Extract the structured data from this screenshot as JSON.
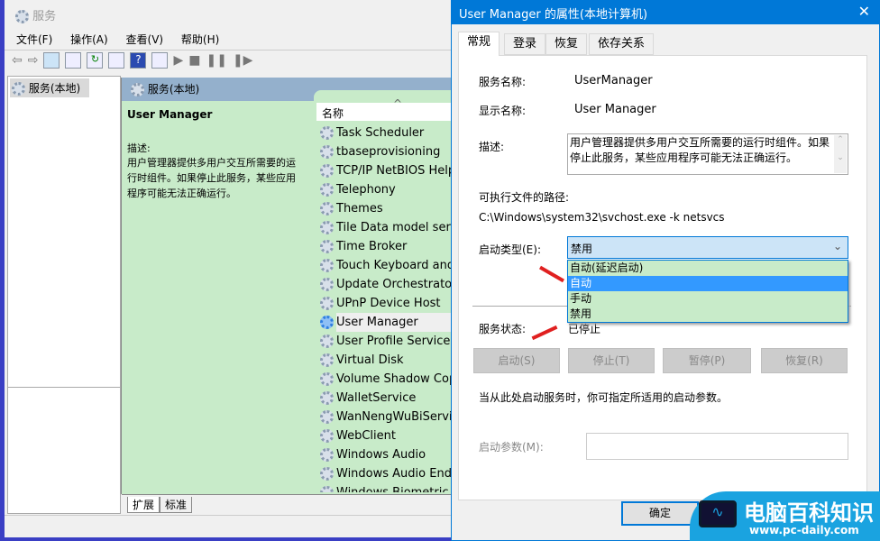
{
  "main_window": {
    "title": "服务",
    "menu": [
      "文件(F)",
      "操作(A)",
      "查看(V)",
      "帮助(H)"
    ],
    "tree": {
      "item": "服务(本地)"
    },
    "pane_header": "服务(本地)",
    "selected_service": {
      "name": "User Manager",
      "desc_label": "描述:",
      "description": "用户管理器提供多用户交互所需要的运行时组件。如果停止此服务，某些应用程序可能无法正确运行。"
    },
    "column_header": "名称",
    "services": [
      "Task Scheduler",
      "tbaseprovisioning",
      "TCP/IP NetBIOS Helper",
      "Telephony",
      "Themes",
      "Tile Data model server",
      "Time Broker",
      "Touch Keyboard and Handwriting",
      "Update Orchestrator Service",
      "UPnP Device Host",
      "User Manager",
      "User Profile Service",
      "Virtual Disk",
      "Volume Shadow Copy",
      "WalletService",
      "WanNengWuBiService",
      "WebClient",
      "Windows Audio",
      "Windows Audio Endpoint",
      "Windows Biometric Service"
    ],
    "selected_index": 10,
    "bottom_tabs": [
      "扩展",
      "标准"
    ]
  },
  "dialog": {
    "title": "User Manager 的属性(本地计算机)",
    "tabs": [
      "常规",
      "登录",
      "恢复",
      "依存关系"
    ],
    "service_name_label": "服务名称:",
    "service_name": "UserManager",
    "display_name_label": "显示名称:",
    "display_name": "User Manager",
    "description_label": "描述:",
    "description": "用户管理器提供多用户交互所需要的运行时组件。如果停止此服务，某些应用程序可能无法正确运行。",
    "path_label": "可执行文件的路径:",
    "path": "C:\\Windows\\system32\\svchost.exe -k netsvcs",
    "startup_type_label": "启动类型(E):",
    "startup_type": "禁用",
    "startup_options": [
      "自动(延迟启动)",
      "自动",
      "手动",
      "禁用"
    ],
    "highlighted_option": 1,
    "status_label": "服务状态:",
    "status": "已停止",
    "buttons": [
      "启动(S)",
      "停止(T)",
      "暂停(P)",
      "恢复(R)"
    ],
    "hint": "当从此处启动服务时，你可指定所适用的启动参数。",
    "param_label": "启动参数(M):",
    "ok": "确定"
  },
  "watermark": {
    "name": "电脑百科知识",
    "url": "www.pc-daily.com"
  },
  "colors": {
    "accent": "#0078d7",
    "green": "#c8ebc9",
    "highlight": "#3399ff"
  }
}
